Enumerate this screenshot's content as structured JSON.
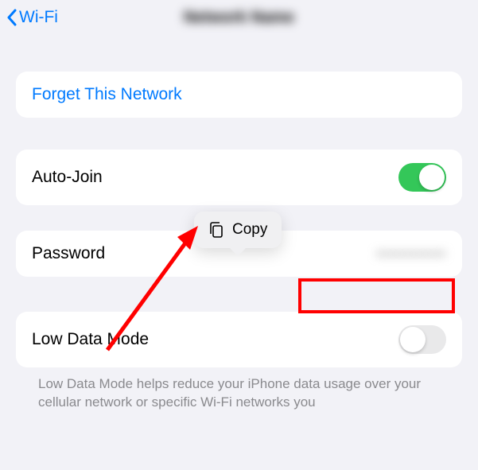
{
  "nav": {
    "back_label": "Wi-Fi",
    "title": "Network Name"
  },
  "rows": {
    "forget": "Forget This Network",
    "autojoin": "Auto-Join",
    "password_label": "Password",
    "password_value": "••••••••••••",
    "lowdata": "Low Data Mode"
  },
  "popover": {
    "copy": "Copy"
  },
  "footer": "Low Data Mode helps reduce your iPhone data usage over your cellular network or specific Wi-Fi networks you"
}
